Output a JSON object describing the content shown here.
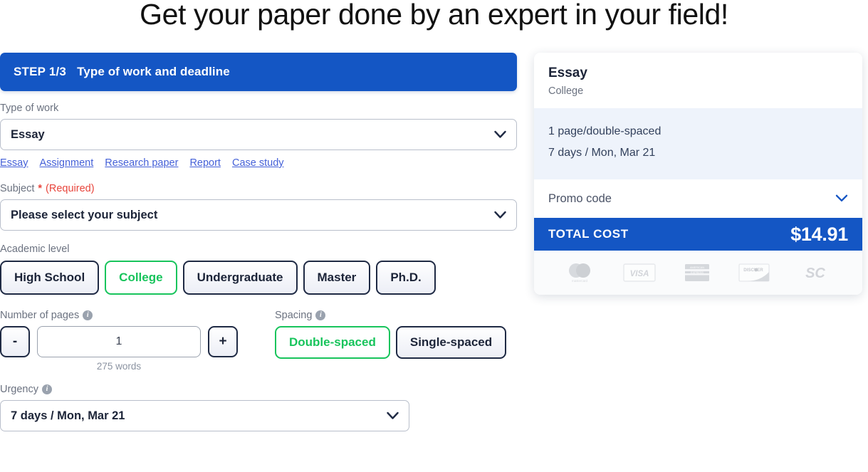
{
  "headline": "Get your paper done by an expert in your field!",
  "step": {
    "number_label": "STEP 1/3",
    "title": "Type of work and deadline"
  },
  "type_of_work": {
    "label": "Type of work",
    "value": "Essay",
    "chevron_icon": "chevron-down-icon",
    "quick_links": [
      "Essay",
      "Assignment",
      "Research paper",
      "Report",
      "Case study"
    ]
  },
  "subject": {
    "label": "Subject",
    "required_star": "*",
    "required_text": "(Required)",
    "value": "Please select your subject",
    "chevron_icon": "chevron-down-icon"
  },
  "academic_level": {
    "label": "Academic level",
    "options": [
      {
        "label": "High School",
        "selected": false
      },
      {
        "label": "College",
        "selected": true
      },
      {
        "label": "Undergraduate",
        "selected": false
      },
      {
        "label": "Master",
        "selected": false
      },
      {
        "label": "Ph.D.",
        "selected": false
      }
    ]
  },
  "pages": {
    "label": "Number of pages",
    "info_icon": "info-icon",
    "decrement_label": "-",
    "increment_label": "+",
    "value": "1",
    "words_note": "275 words"
  },
  "spacing": {
    "label": "Spacing",
    "info_icon": "info-icon",
    "options": [
      {
        "label": "Double-spaced",
        "selected": true
      },
      {
        "label": "Single-spaced",
        "selected": false
      }
    ]
  },
  "urgency": {
    "label": "Urgency",
    "info_icon": "info-icon",
    "value": "7 days / Mon, Mar 21",
    "chevron_icon": "chevron-down-icon"
  },
  "summary": {
    "title": "Essay",
    "subtitle": "College",
    "detail_pages": "1 page/double-spaced",
    "detail_deadline": "7 days / Mon, Mar 21",
    "promo_label": "Promo code",
    "promo_chevron_icon": "chevron-down-icon",
    "total_label": "TOTAL COST",
    "total_value": "$14.91",
    "payment_methods": [
      "mastercard-logo",
      "visa-logo",
      "amex-logo",
      "discover-logo",
      "sc-logo"
    ]
  },
  "colors": {
    "brand_blue": "#1456c4",
    "accent_green": "#18c45c",
    "required_red": "#e8453c",
    "link_blue": "#4561d8",
    "navy_border": "#1f2a44",
    "details_bg": "#eef3fb"
  }
}
